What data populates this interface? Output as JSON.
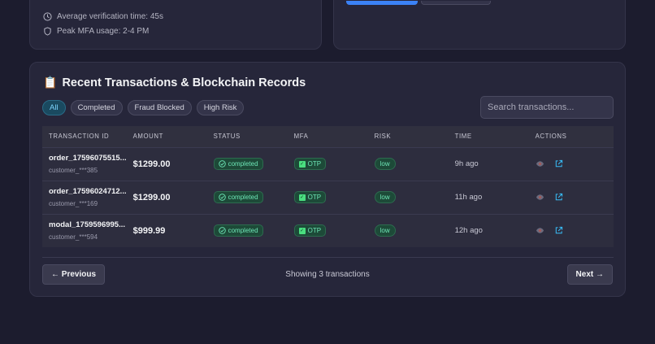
{
  "top_stats": {
    "avg_verification": "Average verification time: 45s",
    "peak_mfa": "Peak MFA usage: 2-4 PM"
  },
  "section": {
    "icon": "clipboard-icon",
    "title": "Recent Transactions & Blockchain Records"
  },
  "filters": [
    "All",
    "Completed",
    "Fraud Blocked",
    "High Risk"
  ],
  "search": {
    "placeholder": "Search transactions..."
  },
  "columns": [
    "TRANSACTION ID",
    "AMOUNT",
    "STATUS",
    "MFA",
    "RISK",
    "TIME",
    "ACTIONS"
  ],
  "rows": [
    {
      "id": "order_17596075515...",
      "customer": "customer_***385",
      "amount": "$1299.00",
      "status": "completed",
      "mfa": "OTP",
      "risk": "low",
      "time": "9h ago"
    },
    {
      "id": "order_17596024712...",
      "customer": "customer_***169",
      "amount": "$1299.00",
      "status": "completed",
      "mfa": "OTP",
      "risk": "low",
      "time": "11h ago"
    },
    {
      "id": "modal_1759596995...",
      "customer": "customer_***594",
      "amount": "$999.99",
      "status": "completed",
      "mfa": "OTP",
      "risk": "low",
      "time": "12h ago"
    }
  ],
  "pagination": {
    "prev": "← Previous",
    "showing": "Showing 3 transactions",
    "next": "Next →"
  },
  "colors": {
    "accent": "#3b82f6",
    "success": "#6ee7b7",
    "link": "#38bdf8"
  }
}
